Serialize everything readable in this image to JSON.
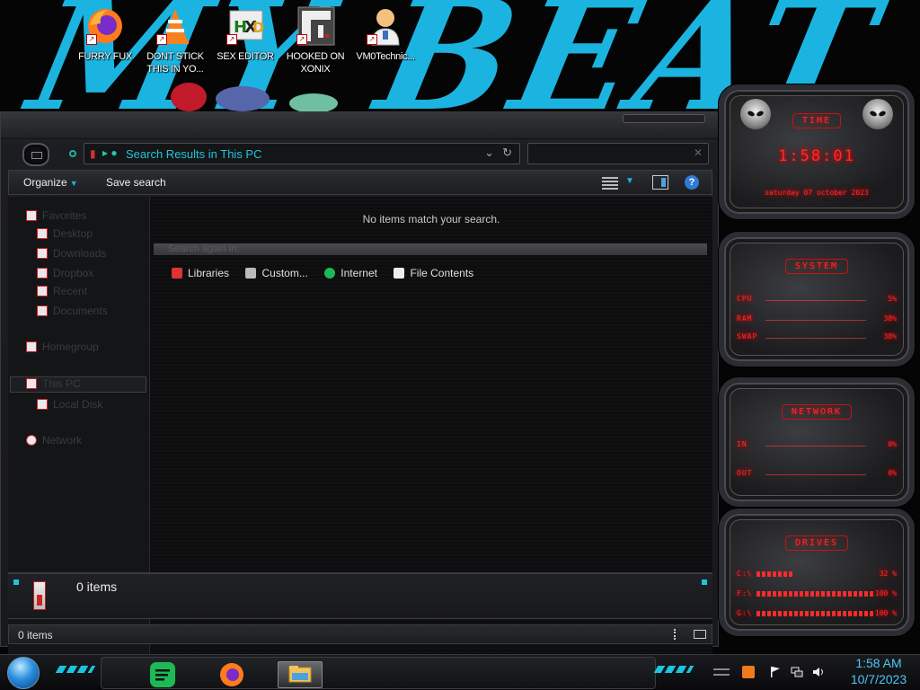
{
  "desktop": {
    "icons": [
      {
        "label": "FURRY FUX",
        "icon": "firefox-icon"
      },
      {
        "label": "DONT STICK THIS IN YO...",
        "icon": "vlc-cone-icon"
      },
      {
        "label": "SEX EDITOR",
        "icon": "hxd-editor-icon"
      },
      {
        "label": "HOOKED ON XONIX",
        "icon": "xonix-game-icon"
      },
      {
        "label": "VM0Technic...",
        "icon": "doctor-avatar-icon"
      }
    ],
    "colors": {
      "wallpaper_accent": "#1bb4e0"
    }
  },
  "explorer": {
    "address": {
      "path_text": "Search Results in This PC",
      "icon": "computer-icon"
    },
    "search": {
      "placeholder": "",
      "value": ""
    },
    "commands": {
      "organize": "Organize",
      "save_search": "Save search",
      "help": "?"
    },
    "navpane_items": [
      "Favorites",
      "Desktop",
      "Downloads",
      "Dropbox",
      "Recent",
      "Documents",
      "Homegroup",
      "This PC",
      "Local Disk",
      "Network"
    ],
    "content": {
      "empty_message": "No items match your search.",
      "search_again_label": "Search again in:",
      "search_again_items": [
        {
          "label": "Libraries",
          "icon": "libraries-icon"
        },
        {
          "label": "Custom...",
          "icon": "custom-folder-icon"
        },
        {
          "label": "Internet",
          "icon": "internet-icon"
        },
        {
          "label": "File Contents",
          "icon": "file-contents-icon"
        }
      ]
    },
    "details_pane": {
      "text": "0 items"
    },
    "status_bar": {
      "text": "0 items"
    }
  },
  "gadgets": {
    "time": {
      "title": "TIME",
      "clock": "1:58:01",
      "date": "saturday 07 october 2023"
    },
    "system": {
      "title": "SYSTEM",
      "rows": [
        {
          "label": "CPU",
          "value": "5%"
        },
        {
          "label": "RAM",
          "value": "38%"
        },
        {
          "label": "SWAP",
          "value": "38%"
        }
      ]
    },
    "network": {
      "title": "NETWORK",
      "rows": [
        {
          "label": "IN",
          "value": "0%"
        },
        {
          "label": "OUT",
          "value": "0%"
        }
      ]
    },
    "drives": {
      "title": "DRIVES",
      "rows": [
        {
          "label": "C:\\",
          "value": "32 %",
          "fill": 0.32
        },
        {
          "label": "F:\\",
          "value": "100 %",
          "fill": 1.0
        },
        {
          "label": "G:\\",
          "value": "100 %",
          "fill": 1.0
        }
      ]
    },
    "colors": {
      "accent": "#ff2a2a"
    }
  },
  "taskbar": {
    "apps": [
      {
        "name": "spotify",
        "icon": "spotify-icon"
      },
      {
        "name": "firefox",
        "icon": "firefox-icon"
      },
      {
        "name": "file-explorer",
        "icon": "file-explorer-icon",
        "active": true
      }
    ],
    "tray_icons": [
      "action-center-icon",
      "flag-icon",
      "network-icon",
      "volume-icon"
    ],
    "time": "1:58 AM",
    "date": "10/7/2023",
    "colors": {
      "accent": "#1bc4e0",
      "clock": "#4cc8f5"
    }
  }
}
